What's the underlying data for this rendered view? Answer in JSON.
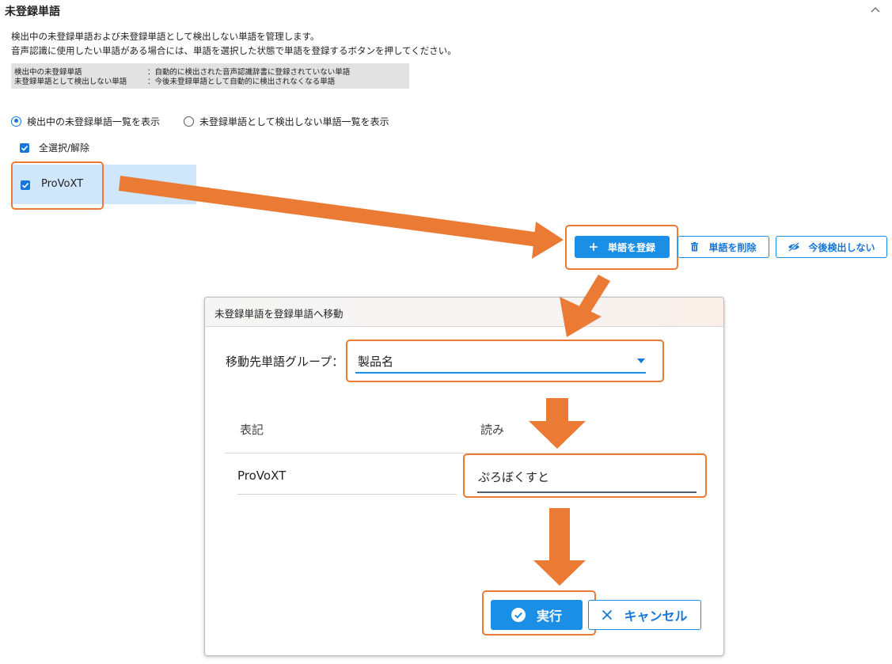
{
  "section": {
    "title": "未登録単語",
    "collapse_icon": "chevron-up-icon",
    "description": [
      "検出中の未登録単語および未登録単語として検出しない単語を管理します。",
      "音声認識に使用したい単語がある場合には、単語を選択した状態で単語を登録するボタンを押してください。"
    ],
    "legend": [
      {
        "term": "検出中の未登録単語",
        "definition": "：自動的に検出された音声認識辞書に登録されていない単語"
      },
      {
        "term": "未登録単語として検出しない単語",
        "definition": "：今後未登録単語として自動的に検出されなくなる単語"
      }
    ]
  },
  "view_options": {
    "option1": "検出中の未登録単語一覧を表示",
    "option2": "未登録単語として検出しない単語一覧を表示",
    "selected": "option1"
  },
  "select_all_label": "全選択/解除",
  "word_list": [
    {
      "text": "ProVoXT",
      "checked": true
    }
  ],
  "toolbar": {
    "register": {
      "label": "単語を登録",
      "icon": "plus-icon"
    },
    "delete": {
      "label": "単語を削除",
      "icon": "trash-icon"
    },
    "ignore": {
      "label": "今後検出しない",
      "icon": "eye-off-icon"
    }
  },
  "dialog": {
    "title": "未登録単語を登録単語へ移動",
    "group_label": "移動先単語グループ：",
    "group_value": "製品名",
    "columns": {
      "notation": "表記",
      "reading": "読み"
    },
    "row": {
      "notation": "ProVoXT",
      "reading": "ぷろぼくすと"
    },
    "execute": {
      "label": "実行",
      "icon": "check-circle-icon"
    },
    "cancel": {
      "label": "キャンセル",
      "icon": "close-icon"
    }
  },
  "colors": {
    "primary": "#1b8ee6",
    "highlight": "#ea7a34",
    "selected_row": "#cfe6fb",
    "legend_bg": "#e2e2e2"
  }
}
